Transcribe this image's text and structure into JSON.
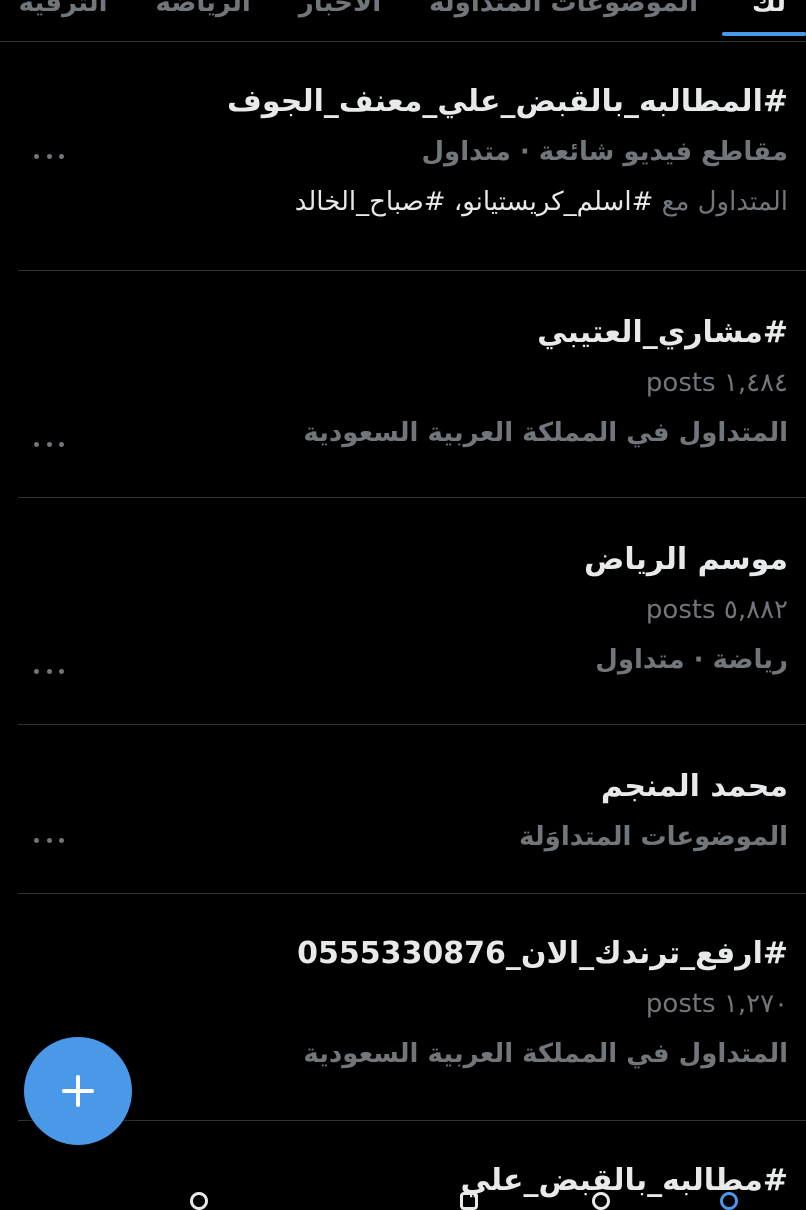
{
  "tabs": [
    {
      "label": "لك",
      "active": true
    },
    {
      "label": "الموضوعات المتداولة",
      "active": false
    },
    {
      "label": "الأخبار",
      "active": false
    },
    {
      "label": "الرياضة",
      "active": false
    },
    {
      "label": "الترفيه",
      "active": false
    }
  ],
  "trends": [
    {
      "title": "#المطالبه_بالقبض_علي_معنف_الجوف",
      "context": "مقاطع فيديو شائعة · متداول",
      "trending_with_prefix": "المتداول مع",
      "trending_with_tags": "#اسلم_كريستيانو، #صباح_الخالد"
    },
    {
      "title": "#مشاري_العتيبي",
      "posts": "١,٤٨٤ posts",
      "context": "المتداول في المملكة العربية السعودية"
    },
    {
      "title": "موسم الرياض",
      "posts": "٥,٨٨٢ posts",
      "context": "رياضة · متداول"
    },
    {
      "title": "محمد المنجم",
      "context": "الموضوعات المتداوَلة"
    },
    {
      "title": "#ارفع_ترندك_الان_0555330876",
      "posts": "١,٢٧٠ posts",
      "context": "المتداول في المملكة العربية السعودية"
    },
    {
      "title": "#مطالبه_بالقبض_علي"
    }
  ],
  "fab": {
    "icon": "plus-icon"
  },
  "colors": {
    "background": "#000000",
    "text_primary": "#e7e9ea",
    "text_secondary": "#71767b",
    "divider": "#2f3336",
    "accent": "#4a99e9"
  }
}
